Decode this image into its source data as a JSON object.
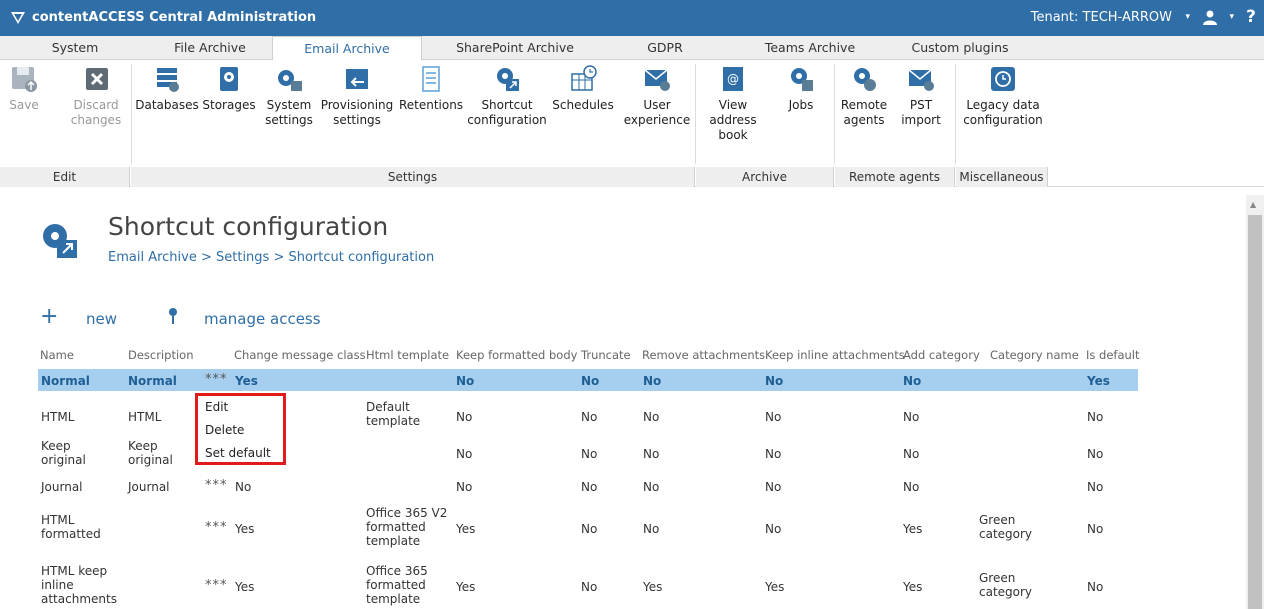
{
  "app": {
    "title": "contentACCESS Central Administration",
    "tenant": "Tenant: TECH-ARROW",
    "help": "?"
  },
  "tabs": [
    "System",
    "File Archive",
    "Email Archive",
    "SharePoint Archive",
    "GDPR",
    "Teams Archive",
    "Custom plugins"
  ],
  "active_tab": "Email Archive",
  "ribbon": {
    "buttons": [
      {
        "label": "Save",
        "icon": "save-icon"
      },
      {
        "label": "Discard changes",
        "icon": "discard-icon"
      },
      {
        "label": "Databases",
        "icon": "database-icon"
      },
      {
        "label": "Storages",
        "icon": "storage-icon"
      },
      {
        "label": "System settings",
        "icon": "system-settings-icon"
      },
      {
        "label": "Provisioning settings",
        "icon": "provisioning-icon"
      },
      {
        "label": "Retentions",
        "icon": "retentions-icon"
      },
      {
        "label": "Shortcut configuration",
        "icon": "shortcut-config-icon"
      },
      {
        "label": "Schedules",
        "icon": "schedules-icon"
      },
      {
        "label": "User experience",
        "icon": "user-experience-icon"
      },
      {
        "label": "View address book",
        "icon": "address-book-icon"
      },
      {
        "label": "Jobs",
        "icon": "jobs-icon"
      },
      {
        "label": "Remote agents",
        "icon": "remote-agents-icon"
      },
      {
        "label": "PST import",
        "icon": "pst-import-icon"
      },
      {
        "label": "Legacy data configuration",
        "icon": "legacy-data-icon"
      }
    ],
    "groups": [
      "Edit",
      "Settings",
      "Archive",
      "Remote agents",
      "Miscellaneous"
    ]
  },
  "page": {
    "title": "Shortcut configuration",
    "breadcrumb": "Email Archive > Settings > Shortcut configuration",
    "actions": {
      "new": "new",
      "manage_access": "manage access"
    }
  },
  "table": {
    "headers": [
      "Name",
      "Description",
      "Change message class",
      "Html template",
      "Keep formatted body",
      "Truncate",
      "Remove attachments",
      "Keep inline attachments",
      "Add category",
      "Category name",
      "Is default"
    ],
    "rows": [
      {
        "name": "Normal",
        "desc": "Normal",
        "dots": "***",
        "cmc": "Yes",
        "html": "",
        "kfb": "No",
        "trunc": "No",
        "rem": "No",
        "kia": "No",
        "addcat": "No",
        "catname": "",
        "def": "Yes"
      },
      {
        "name": "HTML",
        "desc": "HTML",
        "dots": "",
        "cmc": "",
        "html": "Default template",
        "kfb": "No",
        "trunc": "No",
        "rem": "No",
        "kia": "No",
        "addcat": "No",
        "catname": "",
        "def": "No"
      },
      {
        "name": "Keep original",
        "desc": "Keep original",
        "dots": "",
        "cmc": "",
        "html": "",
        "kfb": "No",
        "trunc": "No",
        "rem": "No",
        "kia": "No",
        "addcat": "No",
        "catname": "",
        "def": "No"
      },
      {
        "name": "Journal",
        "desc": "Journal",
        "dots": "***",
        "cmc": "No",
        "html": "",
        "kfb": "No",
        "trunc": "No",
        "rem": "No",
        "kia": "No",
        "addcat": "No",
        "catname": "",
        "def": "No"
      },
      {
        "name": "HTML formatted",
        "desc": "",
        "dots": "***",
        "cmc": "Yes",
        "html": "Office 365 V2 formatted template",
        "kfb": "Yes",
        "trunc": "No",
        "rem": "No",
        "kia": "No",
        "addcat": "Yes",
        "catname": "Green category",
        "def": "No"
      },
      {
        "name": "HTML keep inline attachments",
        "desc": "",
        "dots": "***",
        "cmc": "Yes",
        "html": "Office 365 formatted template",
        "kfb": "Yes",
        "trunc": "No",
        "rem": "Yes",
        "kia": "Yes",
        "addcat": "Yes",
        "catname": "Green category",
        "def": "No"
      }
    ]
  },
  "context_menu": [
    "Edit",
    "Delete",
    "Set default"
  ],
  "colors": {
    "accent": "#2f6ea6",
    "selected_row": "#a6cfef",
    "highlight_box": "#e01b1b"
  }
}
